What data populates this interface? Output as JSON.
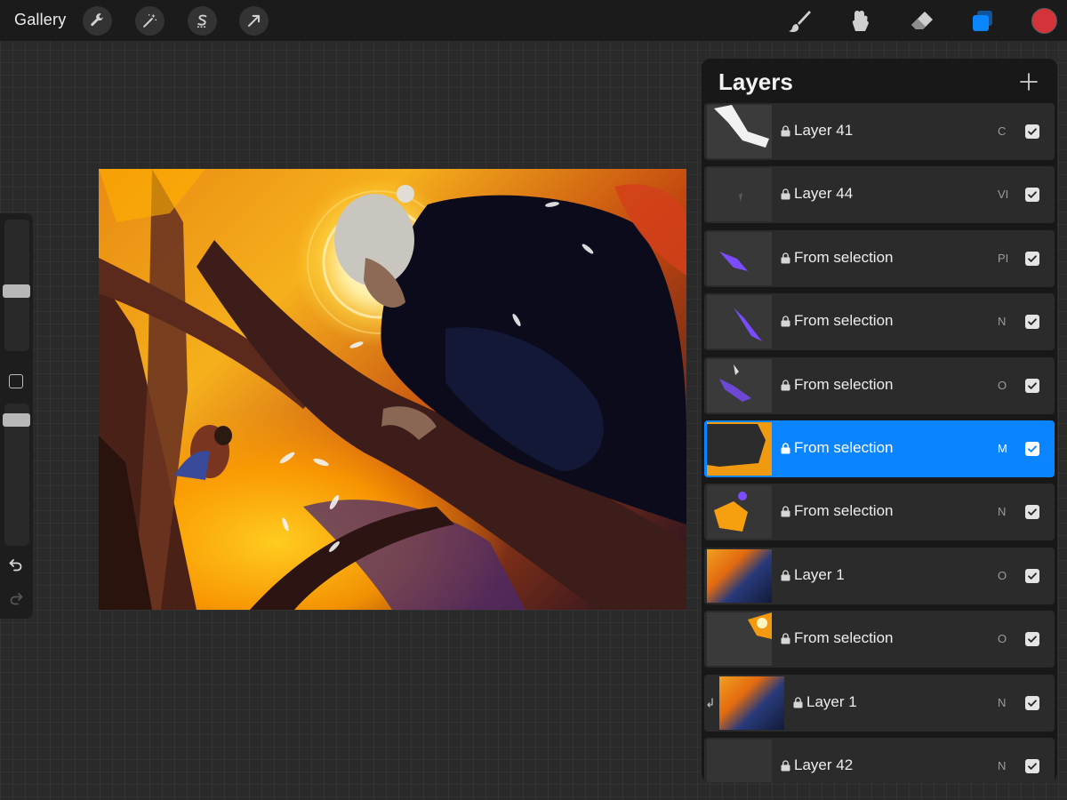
{
  "toolbar": {
    "gallery_label": "Gallery",
    "left_tools": [
      "wrench-icon",
      "magic-wand-icon",
      "selection-s-icon",
      "transform-arrow-icon"
    ],
    "right_tools": [
      "brush-icon",
      "smudge-icon",
      "eraser-icon",
      "layers-icon"
    ],
    "active_tool": "layers-icon",
    "current_color": "#d5333a",
    "accent_color": "#0a84ff"
  },
  "sidebar": {
    "brush_size": 0.45,
    "brush_opacity": 0.15
  },
  "layers_panel": {
    "title": "Layers",
    "add_icon": "plus-icon",
    "layers": [
      {
        "name": "Layer 41",
        "blend": "C",
        "visible": true,
        "selected": false,
        "clipped": false
      },
      {
        "name": "Layer 44",
        "blend": "VI",
        "visible": true,
        "selected": false,
        "clipped": false
      },
      {
        "name": "From selection",
        "blend": "PI",
        "visible": true,
        "selected": false,
        "clipped": false
      },
      {
        "name": "From selection",
        "blend": "N",
        "visible": true,
        "selected": false,
        "clipped": false
      },
      {
        "name": "From selection",
        "blend": "O",
        "visible": true,
        "selected": false,
        "clipped": false
      },
      {
        "name": "From selection",
        "blend": "M",
        "visible": true,
        "selected": true,
        "clipped": false
      },
      {
        "name": "From selection",
        "blend": "N",
        "visible": true,
        "selected": false,
        "clipped": false
      },
      {
        "name": "Layer 1",
        "blend": "O",
        "visible": true,
        "selected": false,
        "clipped": false
      },
      {
        "name": "From selection",
        "blend": "O",
        "visible": true,
        "selected": false,
        "clipped": false
      },
      {
        "name": "Layer 1",
        "blend": "N",
        "visible": true,
        "selected": false,
        "clipped": true
      },
      {
        "name": "Layer 42",
        "blend": "N",
        "visible": true,
        "selected": false,
        "clipped": false
      }
    ]
  }
}
